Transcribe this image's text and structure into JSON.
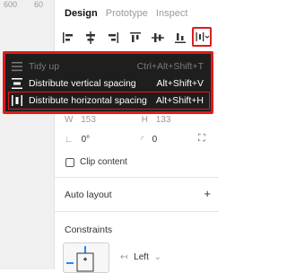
{
  "ruler": {
    "label": "600",
    "label2": "60"
  },
  "tabs": [
    {
      "label": "Design"
    },
    {
      "label": "Prototype"
    },
    {
      "label": "Inspect"
    }
  ],
  "menu": {
    "items": [
      {
        "label": "Tidy up",
        "shortcut": "Ctrl+Alt+Shift+T",
        "icon": "tidy-up-icon",
        "enabled": false
      },
      {
        "label": "Distribute vertical spacing",
        "shortcut": "Alt+Shift+V",
        "icon": "distribute-vertical-icon",
        "enabled": true
      },
      {
        "label": "Distribute horizontal spacing",
        "shortcut": "Alt+Shift+H",
        "icon": "distribute-horizontal-icon",
        "enabled": true
      }
    ]
  },
  "dimensions": {
    "w_label": "W",
    "w_value": "153",
    "h_label": "H",
    "h_value": "133"
  },
  "rotation": {
    "value": "0°",
    "radius": "0"
  },
  "clip_content": {
    "label": "Clip content"
  },
  "auto_layout": {
    "title": "Auto layout",
    "add": "+"
  },
  "constraints": {
    "title": "Constraints",
    "horizontal": "Left",
    "chevron": "⌄"
  },
  "colors": {
    "highlight": "#e01b1b",
    "menu_bg": "#1e1e1e"
  }
}
